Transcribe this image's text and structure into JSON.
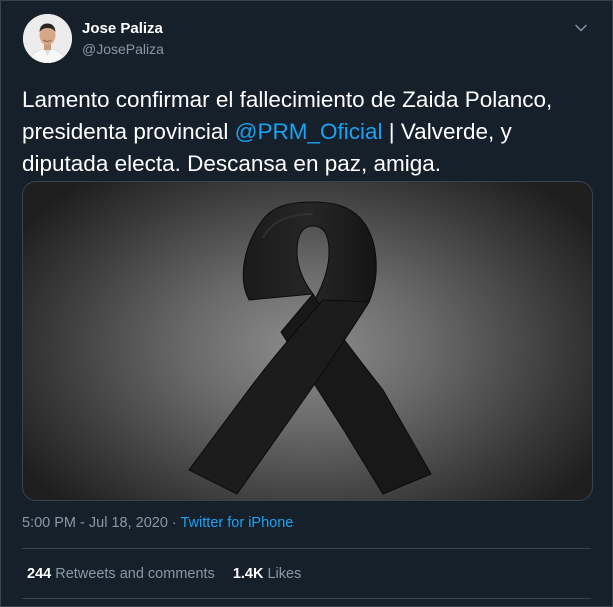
{
  "author": {
    "name": "Jose Paliza",
    "handle": "@JosePaliza"
  },
  "tweet": {
    "text_before": "Lamento confirmar el fallecimiento de Zaida Polanco, presidenta provincial ",
    "mention": "@PRM_Oficial",
    "text_after": " | Valverde, y diputada electa. Descansa en paz, amiga."
  },
  "meta": {
    "time": "5:00 PM",
    "date": "Jul 18, 2020",
    "separator": " · ",
    "source": "Twitter for iPhone"
  },
  "stats": {
    "retweets_count": "244",
    "retweets_label": "Retweets and comments",
    "likes_count": "1.4K",
    "likes_label": "Likes"
  },
  "icons": {
    "caret": "chevron-down-icon",
    "media": "black-ribbon-image"
  },
  "colors": {
    "background": "#15202b",
    "accent": "#1da1f2",
    "muted": "#8899a6",
    "border": "#38444d"
  }
}
